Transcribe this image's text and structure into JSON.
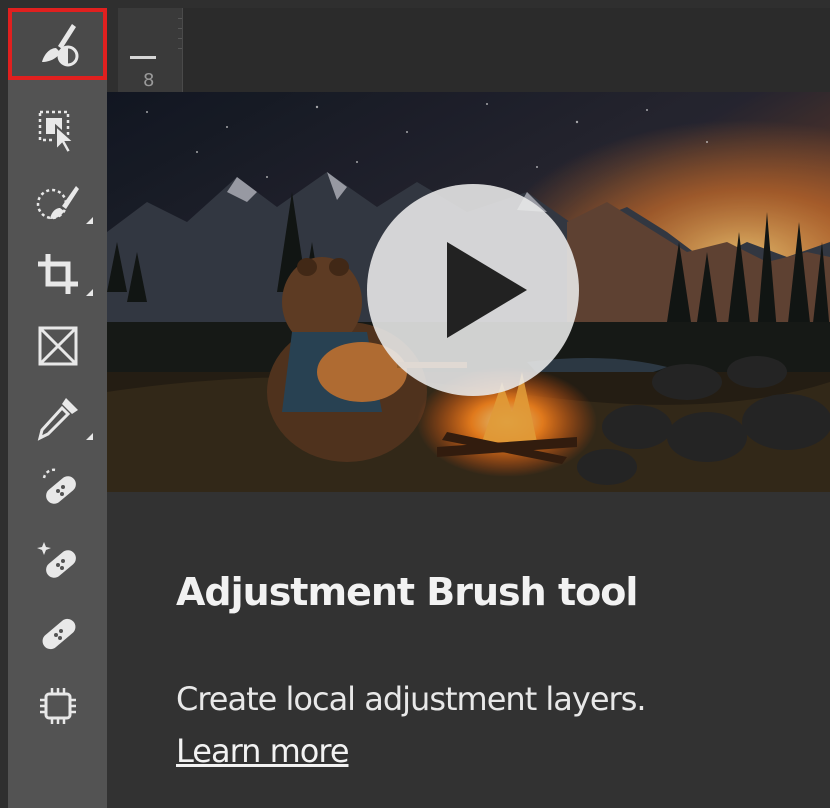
{
  "toolbar": {
    "tools": [
      {
        "icon": "adjustment-brush-icon",
        "selected": true,
        "has_flyout": false
      },
      {
        "icon": "object-selection-icon",
        "selected": false,
        "has_flyout": true
      },
      {
        "icon": "quick-selection-brush-icon",
        "selected": false,
        "has_flyout": true
      },
      {
        "icon": "crop-icon",
        "selected": false,
        "has_flyout": true
      },
      {
        "icon": "frame-icon",
        "selected": false,
        "has_flyout": false
      },
      {
        "icon": "eyedropper-icon",
        "selected": false,
        "has_flyout": true
      },
      {
        "icon": "spot-healing-brush-icon",
        "selected": false,
        "has_flyout": false
      },
      {
        "icon": "remove-tool-icon",
        "selected": false,
        "has_flyout": false
      },
      {
        "icon": "healing-brush-icon",
        "selected": false,
        "has_flyout": false
      },
      {
        "icon": "patch-chip-icon",
        "selected": false,
        "has_flyout": false
      }
    ],
    "selected_outline_color": "#e0201f"
  },
  "ruler": {
    "label": "8"
  },
  "tooltip": {
    "title": "Adjustment Brush tool",
    "description": "Create local adjustment layers.",
    "link_label": "Learn more",
    "video": {
      "icon": "play-icon"
    }
  }
}
